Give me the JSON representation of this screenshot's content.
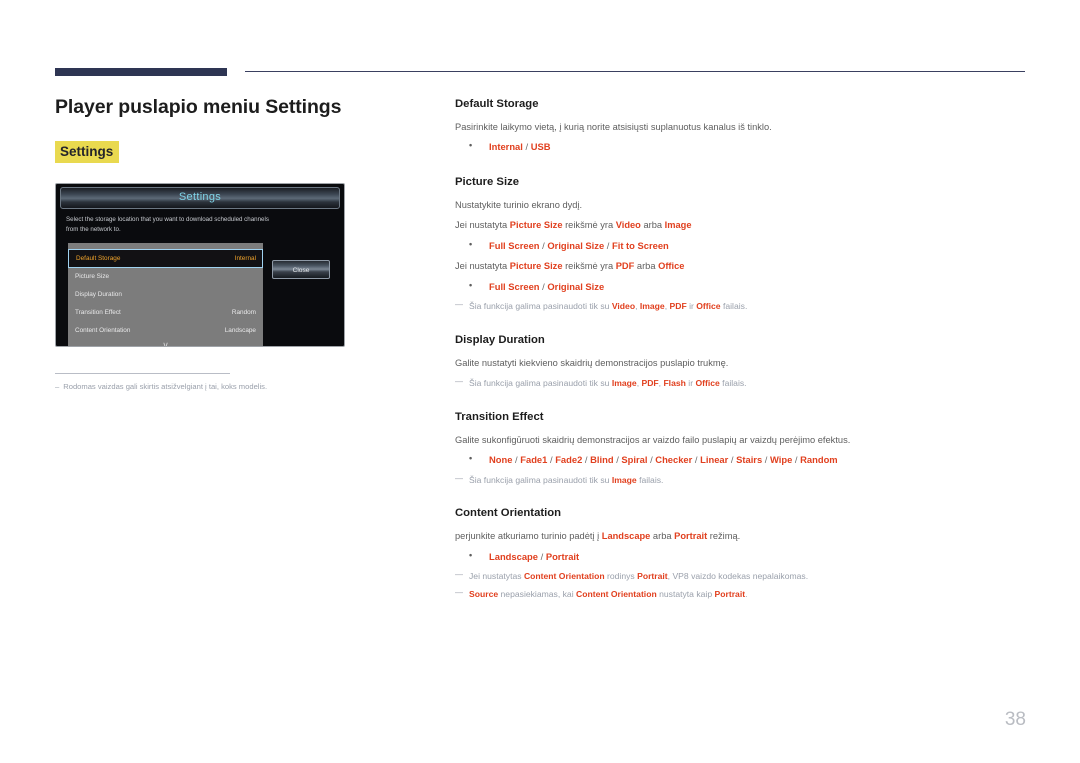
{
  "page": {
    "title": "Player puslapio meniu Settings",
    "highlight_heading": "Settings",
    "page_number": "38",
    "accent_red": "#e1401f",
    "highlight_yellow": "#e9d94f",
    "header_bar_color": "#2e3553"
  },
  "device_shot": {
    "window_title": "Settings",
    "description": "Select the storage location that you want to download scheduled channels from the network to.",
    "rows": [
      {
        "label": "Default Storage",
        "value": "Internal",
        "selected": true
      },
      {
        "label": "Picture Size",
        "value": "",
        "selected": false
      },
      {
        "label": "Display Duration",
        "value": "",
        "selected": false
      },
      {
        "label": "Transition Effect",
        "value": "Random",
        "selected": false
      },
      {
        "label": "Content Orientation",
        "value": "Landscape",
        "selected": false
      }
    ],
    "scroll_chevron": "∨",
    "close_button": "Close"
  },
  "left_note": {
    "dash": "–",
    "text": "Rodomas vaizdas gali skirtis atsižvelgiant į tai, koks modelis."
  },
  "sections": [
    {
      "title": "Default Storage",
      "lines": [
        {
          "type": "body",
          "html": "Pasirinkite laikymo vietą, į kurią norite atsisiųsti suplanuotus kanalus iš tinklo."
        },
        {
          "type": "bullet",
          "html": "<b>Internal</b> <span class=\"sep\">/</span> <b>USB</b>"
        }
      ]
    },
    {
      "title": "Picture Size",
      "lines": [
        {
          "type": "body",
          "html": "Nustatykite turinio ekrano dydį."
        },
        {
          "type": "body",
          "html": "Jei nustatyta <b>Picture Size</b> reikšmė yra <b>Video</b> arba <b>Image</b>"
        },
        {
          "type": "bullet",
          "html": "<b>Full Screen</b> <span class=\"sep\">/</span> <b>Original Size</b> <span class=\"sep\">/</span> <b>Fit to Screen</b>"
        },
        {
          "type": "body",
          "html": "Jei nustatyta <b>Picture Size</b> reikšmė yra <b>PDF</b> arba <b>Office</b>"
        },
        {
          "type": "bullet",
          "html": "<b>Full Screen</b> <span class=\"sep\">/</span> <b>Original Size</b>"
        },
        {
          "type": "note",
          "html": "Šia funkcija galima pasinaudoti tik su <b>Video</b>, <b>Image</b>, <b>PDF</b> ir <b>Office</b> failais."
        }
      ]
    },
    {
      "title": "Display Duration",
      "lines": [
        {
          "type": "body",
          "html": "Galite nustatyti kiekvieno skaidrių demonstracijos puslapio trukmę."
        },
        {
          "type": "note",
          "html": "Šia funkcija galima pasinaudoti tik su <b>Image</b>, <b>PDF</b>, <b>Flash</b> ir <b>Office</b> failais."
        }
      ]
    },
    {
      "title": "Transition Effect",
      "lines": [
        {
          "type": "body",
          "html": "Galite sukonfigūruoti skaidrių demonstracijos ar vaizdo failo puslapių ar vaizdų perėjimo efektus."
        },
        {
          "type": "bullet",
          "html": "<b>None</b> <span class=\"sep\">/</span> <b>Fade1</b> <span class=\"sep\">/</span> <b>Fade2</b> <span class=\"sep\">/</span> <b>Blind</b> <span class=\"sep\">/</span> <b>Spiral</b> <span class=\"sep\">/</span> <b>Checker</b> <span class=\"sep\">/</span> <b>Linear</b> <span class=\"sep\">/</span> <b>Stairs</b> <span class=\"sep\">/</span> <b>Wipe</b> <span class=\"sep\">/</span> <b>Random</b>"
        },
        {
          "type": "note",
          "html": "Šia funkcija galima pasinaudoti tik su <b>Image</b> failais."
        }
      ]
    },
    {
      "title": "Content Orientation",
      "lines": [
        {
          "type": "body",
          "html": "perjunkite atkuriamo turinio padėtį į <b>Landscape</b> arba <b>Portrait</b> režimą."
        },
        {
          "type": "bullet",
          "html": "<b>Landscape</b> <span class=\"sep\">/</span> <b>Portrait</b>"
        },
        {
          "type": "note",
          "html": "Jei nustatytas <b>Content Orientation</b> rodinys <b>Portrait</b>, VP8 vaizdo kodekas nepalaikomas."
        },
        {
          "type": "note",
          "html": "<b>Source</b> nepasiekiamas, kai <b>Content Orientation</b> nustatyta kaip <b>Portrait</b>."
        }
      ]
    }
  ]
}
